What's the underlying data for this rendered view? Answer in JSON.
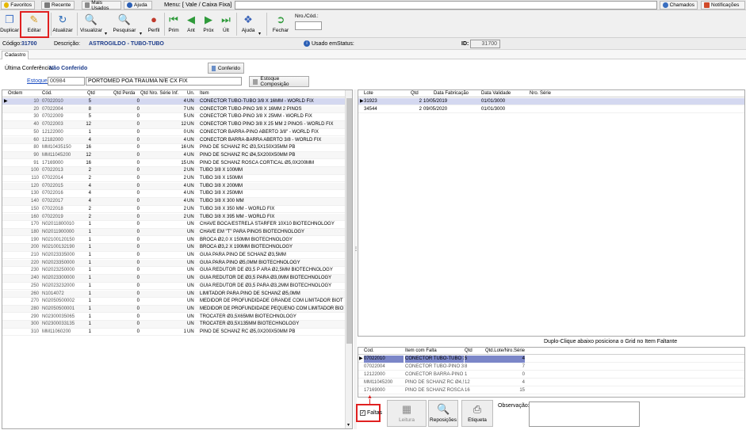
{
  "topbar": {
    "favoritos": "Favoritos",
    "recente": "Recente",
    "mais_usados": "Mais Usados",
    "ajuda": "Ajuda",
    "menu_label": "Menu: [ Vale / Caixa Fixa]",
    "chamados": "Chamados",
    "notificacoes": "Notificações"
  },
  "toolbar": {
    "duplicar": "Duplicar",
    "editar": "Editar",
    "atualizar": "Atualizar",
    "visualizar": "Visualizar",
    "pesquisar": "Pesquisar",
    "perfil": "Perfil",
    "prim": "Prim",
    "ant": "Ant",
    "prox": "Próx",
    "ult": "Últ",
    "ajuda": "Ajuda",
    "fechar": "Fechar",
    "nro_cod_label": "Nro./Cód.:",
    "nro_cod_value": ""
  },
  "info": {
    "codigo_label": "Código:",
    "codigo_value": "31700",
    "descricao_label": "Descrição:",
    "descricao_value": "ASTROGILDO - TUBO-TUBO",
    "usado_em": "Usado em",
    "status_label": "Status:",
    "id_label": "ID:",
    "id_value": "31700"
  },
  "tab": {
    "cadastro": "Cadastro"
  },
  "cadastro": {
    "ultima_conf_label": "Última Conferência:",
    "ultima_conf_value": "Não Conferido",
    "conferido_button": "Conferido",
    "estoque_label": "Estoque:",
    "estoque_code": "00984",
    "estoque_desc": "PORTOMED POA TRAUMA N/E CX FIX",
    "estoque_comp_button": "Estoque Composição"
  },
  "main_grid": {
    "headers": [
      "Ordem",
      "Cód.",
      "Qtd",
      "Qtd Perda",
      "Qtd Nro. Série Inf.",
      "Un.",
      "Item"
    ],
    "rows": [
      [
        "10",
        "07022010",
        "5",
        "0",
        "4",
        "UN",
        "CONECTOR TUBO-TUBO 3/8 X 16MM - WORLD FIX"
      ],
      [
        "20",
        "07022004",
        "8",
        "0",
        "7",
        "UN",
        "CONECTOR TUBO-PINO 3/8 X 16MM 2 PINOS"
      ],
      [
        "30",
        "07022009",
        "5",
        "0",
        "5",
        "UN",
        "CONECTOR TUBO-PINO 3/8 X 25MM - WORLD FIX"
      ],
      [
        "40",
        "07022003",
        "12",
        "0",
        "12",
        "UN",
        "CONECTOR TUBO PINO 3/8 X 25 MM 2 PINOS - WORLD FIX"
      ],
      [
        "50",
        "12122000",
        "1",
        "0",
        "0",
        "UN",
        "CONECTOR BARRA-PINO ABERTO 3/8\" - WORLD FIX"
      ],
      [
        "60",
        "12182000",
        "4",
        "0",
        "4",
        "UN",
        "CONECTOR BARRA-BARRA ABERTO 3/8 - WORLD FIX"
      ],
      [
        "80",
        "MM10435150",
        "16",
        "0",
        "16",
        "UN",
        "PINO DE SCHANZ RC Ø3,5X150X35MM PB"
      ],
      [
        "90",
        "MM11045200",
        "12",
        "0",
        "4",
        "UN",
        "PINO DE SCHANZ RC Ø4,5X200X50MM PB"
      ],
      [
        "91",
        "17169000",
        "16",
        "0",
        "15",
        "UN",
        "PINO DE SCHANZ ROSCA CORTICAL Ø5,0X200MM"
      ],
      [
        "100",
        "07022013",
        "2",
        "0",
        "2",
        "UN",
        "TUBO 3/8 X 100MM"
      ],
      [
        "110",
        "07022014",
        "2",
        "0",
        "2",
        "UN",
        "TUBO 3/8 X 150MM"
      ],
      [
        "120",
        "07022015",
        "4",
        "0",
        "4",
        "UN",
        "TUBO 3/8 X 200MM"
      ],
      [
        "130",
        "07022016",
        "4",
        "0",
        "4",
        "UN",
        "TUBO 3/8 X 250MM"
      ],
      [
        "140",
        "07022017",
        "4",
        "0",
        "4",
        "UN",
        "TUBO 3/8 X 300 MM"
      ],
      [
        "150",
        "07022018",
        "2",
        "0",
        "2",
        "UN",
        "TUBO 3/8 X 350 MM - WORLD FIX"
      ],
      [
        "160",
        "07022019",
        "2",
        "0",
        "2",
        "UN",
        "TUBO 3/8 X 395 MM - WORLD FIX"
      ],
      [
        "170",
        "N02011800010",
        "1",
        "0",
        "",
        "UN",
        "CHAVE BOCA/ESTRELA STARFER 10X10 BIOTECHNOLOGY"
      ],
      [
        "180",
        "N02011900000",
        "1",
        "0",
        "",
        "UN",
        "CHAVE EM \"T\" PARA PINOS BIOTECHNOLOGY"
      ],
      [
        "190",
        "N02100120150",
        "1",
        "0",
        "",
        "UN",
        "BROCA Ø2,0 X 150MM BIOTECHNOLOGY"
      ],
      [
        "200",
        "N02100132190",
        "1",
        "0",
        "",
        "UN",
        "BROCA Ø3,2 X 190MM BIOTECHNOLOGY"
      ],
      [
        "210",
        "N02023335000",
        "1",
        "0",
        "",
        "UN",
        "GUIA PARA PINO DE SCHANZ  Ø3,5MM"
      ],
      [
        "220",
        "N02023350000",
        "1",
        "0",
        "",
        "UN",
        "GUIA PARA PINO Ø5,0MM BIOTECHNOLOGY"
      ],
      [
        "230",
        "N02023250000",
        "1",
        "0",
        "",
        "UN",
        "GUIA REDUTOR DE Ø3,5 P ARA Ø2,5MM BIOTECHNOLOGY"
      ],
      [
        "240",
        "N02023300000",
        "1",
        "0",
        "",
        "UN",
        "GUIA REDUTOR DE Ø3,5 PARA Ø3,0MM BIOTECHNOLOGY"
      ],
      [
        "250",
        "N02023232000",
        "1",
        "0",
        "",
        "UN",
        "GUIA REDUTOR DE Ø3,5 PARA Ø3,2MM BIOTECHNOLOGY"
      ],
      [
        "260",
        "N1014072",
        "1",
        "0",
        "",
        "UN",
        "LIMITADOR PARA PINO DE SCHANZ Ø5,0MM"
      ],
      [
        "270",
        "N02050500002",
        "1",
        "0",
        "",
        "UN",
        "MEDIDOR DE PROFUNDIDADE GRANDE COM LIMITADOR BIOT"
      ],
      [
        "280",
        "N02050500001",
        "1",
        "0",
        "",
        "UN",
        "MEDIDOR DE PROFUNDIDADE PEQUENO COM LIMITADOR BIO"
      ],
      [
        "290",
        "N02300035065",
        "1",
        "0",
        "",
        "UN",
        "TROCATER Ø3,5X65MM BIOTECHNOLOGY"
      ],
      [
        "300",
        "N02300033135",
        "1",
        "0",
        "",
        "UN",
        "TROCATER Ø3,5X135MM BIOTECHNOLOGY"
      ],
      [
        "310",
        "MM11060200",
        "1",
        "0",
        "1",
        "UN",
        "PINO DE SCHANZ RC Ø5,0X200X50MM PB"
      ]
    ]
  },
  "lote_grid": {
    "headers": [
      "Lote",
      "Qtd",
      "Data Fabricação",
      "Data Validade",
      "Nro. Série"
    ],
    "rows": [
      [
        "31923",
        "2",
        "10/05/2019",
        "01/01/3000",
        ""
      ],
      [
        "34544",
        "2",
        "09/05/2020",
        "01/01/3000",
        ""
      ]
    ]
  },
  "faltas": {
    "hint": "Duplo-Clique abaixo posiciona o Grid no Item Faltante",
    "headers": [
      "Cod.",
      "Item com Falta",
      "Qtd",
      "Qtd.Lote/Nro.Série"
    ],
    "rows": [
      [
        "07022010",
        "CONECTOR TUBO-TUBO 3/8",
        "5",
        "4"
      ],
      [
        "07022004",
        "CONECTOR TUBO-PINO 3/8",
        "8",
        "7"
      ],
      [
        "12122000",
        "CONECTOR BARRA-PINO A",
        "1",
        "0"
      ],
      [
        "MM11045200",
        "PINO DE SCHANZ RC Ø4,5X",
        "12",
        "4"
      ],
      [
        "17169000",
        "PINO DE SCHANZ ROSCA C",
        "16",
        "15"
      ]
    ]
  },
  "bottom": {
    "faltas_label": "Faltas",
    "faltas_checked": true,
    "leitura": "Leitura",
    "reposicoes": "Reposições",
    "etiqueta": "Etiqueta",
    "observacao_label": "Observação:",
    "observacao_value": ""
  },
  "colors": {
    "highlight": "#e02020",
    "selected_row": "#d4d8f0",
    "accent_blue": "#1a3a8a",
    "faltas_selected": "#7b86c8"
  }
}
